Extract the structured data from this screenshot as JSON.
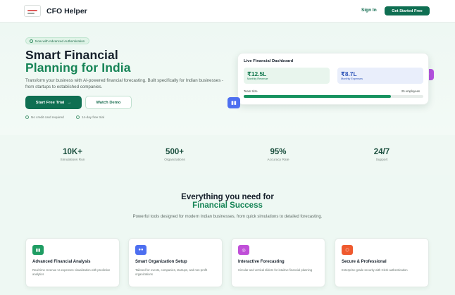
{
  "nav": {
    "brand": "CFO Helper",
    "sign_in": "Sign In",
    "get_started": "Get Started Free"
  },
  "hero": {
    "badge": "Now with Advanced Authentication",
    "title_line1": "Smart Financial",
    "title_line2": "Planning for India",
    "lead": "Transform your business with AI-powered financial forecasting. Built specifically for Indian businesses - from startups to established companies.",
    "cta_primary": "Start Free Trial",
    "cta_primary_arrow": "→",
    "cta_secondary": "Watch Demo",
    "note1": "No credit card required",
    "note2": "14-day free trial"
  },
  "dashboard": {
    "title": "Live Financial Dashboard",
    "revenue_value": "₹12.5L",
    "revenue_label": "Monthly Revenue",
    "expenses_value": "₹8.7L",
    "expenses_label": "Monthly Expenses",
    "team_label": "Team Size",
    "team_value": "25 employees",
    "team_progress": 0.82
  },
  "stats": [
    {
      "value": "10K+",
      "label": "Simulations Run"
    },
    {
      "value": "500+",
      "label": "Organizations"
    },
    {
      "value": "95%",
      "label": "Accuracy Rate"
    },
    {
      "value": "24/7",
      "label": "Support"
    }
  ],
  "features": {
    "heading_line1": "Everything you need for",
    "heading_line2": "Financial Success",
    "subheading": "Powerful tools designed for modern Indian businesses, from quick simulations to detailed forecasting.",
    "cards": [
      {
        "title": "Advanced Financial Analysis",
        "desc": "Real-time revenue vs expenses visualization with predictive analytics",
        "icon": "bar-chart-icon",
        "color": "#1f9d63"
      },
      {
        "title": "Smart Organization Setup",
        "desc": "Tailored for events, companies, startups, and non-profit organizations",
        "icon": "users-icon",
        "color": "#4d6ff0"
      },
      {
        "title": "Interactive Forecasting",
        "desc": "Circular and vertical sliders for intuitive financial planning",
        "icon": "target-icon",
        "color": "#c04fd8"
      },
      {
        "title": "Secure & Professional",
        "desc": "Enterprise-grade security with Clerk authentication",
        "icon": "shield-icon",
        "color": "#ef5a2f"
      }
    ]
  }
}
